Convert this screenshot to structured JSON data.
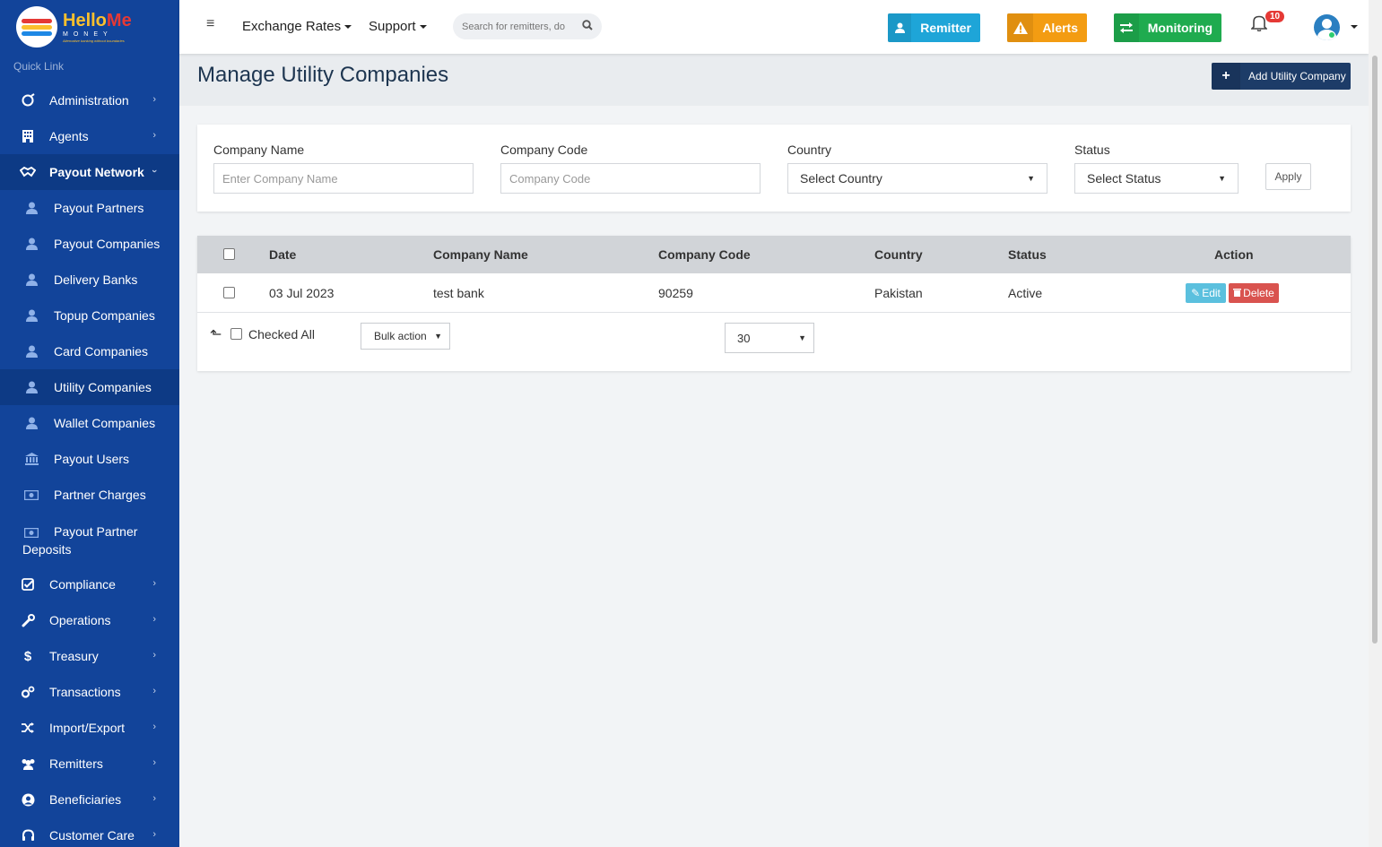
{
  "brand": {
    "name_a": "Hello",
    "name_b": "Me",
    "sub": "MONEY",
    "tagline": "Alternative banking without boundaries"
  },
  "sidebar": {
    "quick_link": "Quick Link",
    "items": [
      {
        "label": "Administration",
        "icon": "cog-icon"
      },
      {
        "label": "Agents",
        "icon": "building-icon"
      },
      {
        "label": "Payout Network",
        "icon": "handshake-icon"
      }
    ],
    "payout_sub": [
      {
        "label": "Payout Partners",
        "icon": "user-icon"
      },
      {
        "label": "Payout Companies",
        "icon": "user-icon"
      },
      {
        "label": "Delivery Banks",
        "icon": "user-icon"
      },
      {
        "label": "Topup Companies",
        "icon": "user-icon"
      },
      {
        "label": "Card Companies",
        "icon": "user-icon"
      },
      {
        "label": "Utility Companies",
        "icon": "user-icon"
      },
      {
        "label": "Wallet Companies",
        "icon": "user-icon"
      },
      {
        "label": "Payout Users",
        "icon": "bank-icon"
      },
      {
        "label": "Partner Charges",
        "icon": "money-icon"
      },
      {
        "label": "Payout Partner Deposits",
        "icon": "money-icon"
      }
    ],
    "lower": [
      {
        "label": "Compliance",
        "icon": "check-square-icon"
      },
      {
        "label": "Operations",
        "icon": "wrench-icon"
      },
      {
        "label": "Treasury",
        "icon": "dollar-icon"
      },
      {
        "label": "Transactions",
        "icon": "cogs-icon"
      },
      {
        "label": "Import/Export",
        "icon": "shuffle-icon"
      },
      {
        "label": "Remitters",
        "icon": "users-icon"
      },
      {
        "label": "Beneficiaries",
        "icon": "user-circle-icon"
      },
      {
        "label": "Customer Care",
        "icon": "headset-icon"
      }
    ]
  },
  "topbar": {
    "exchange_rates": "Exchange Rates",
    "support": "Support",
    "search_placeholder": "Search for remitters, do",
    "remitter": "Remitter",
    "alerts": "Alerts",
    "monitoring": "Monitoring",
    "notif_count": "10",
    "colors": {
      "remitter": "#1ea5d8",
      "alerts": "#f39c12",
      "monitoring": "#1fab4f"
    }
  },
  "page": {
    "title": "Manage Utility Companies",
    "add_button": "Add Utility Company"
  },
  "filters": {
    "company_name_label": "Company Name",
    "company_name_placeholder": "Enter Company Name",
    "company_code_label": "Company Code",
    "company_code_placeholder": "Company Code",
    "country_label": "Country",
    "country_value": "Select Country",
    "status_label": "Status",
    "status_value": "Select Status",
    "apply": "Apply"
  },
  "table": {
    "headers": {
      "date": "Date",
      "company_name": "Company Name",
      "company_code": "Company Code",
      "country": "Country",
      "status": "Status",
      "action": "Action"
    },
    "rows": [
      {
        "date": "03 Jul 2023",
        "company_name": "test bank",
        "company_code": "90259",
        "country": "Pakistan",
        "status": "Active"
      }
    ],
    "edit": "Edit",
    "delete": "Delete",
    "checked_all": "Checked All",
    "bulk_action": "Bulk action",
    "per_page": "30"
  }
}
